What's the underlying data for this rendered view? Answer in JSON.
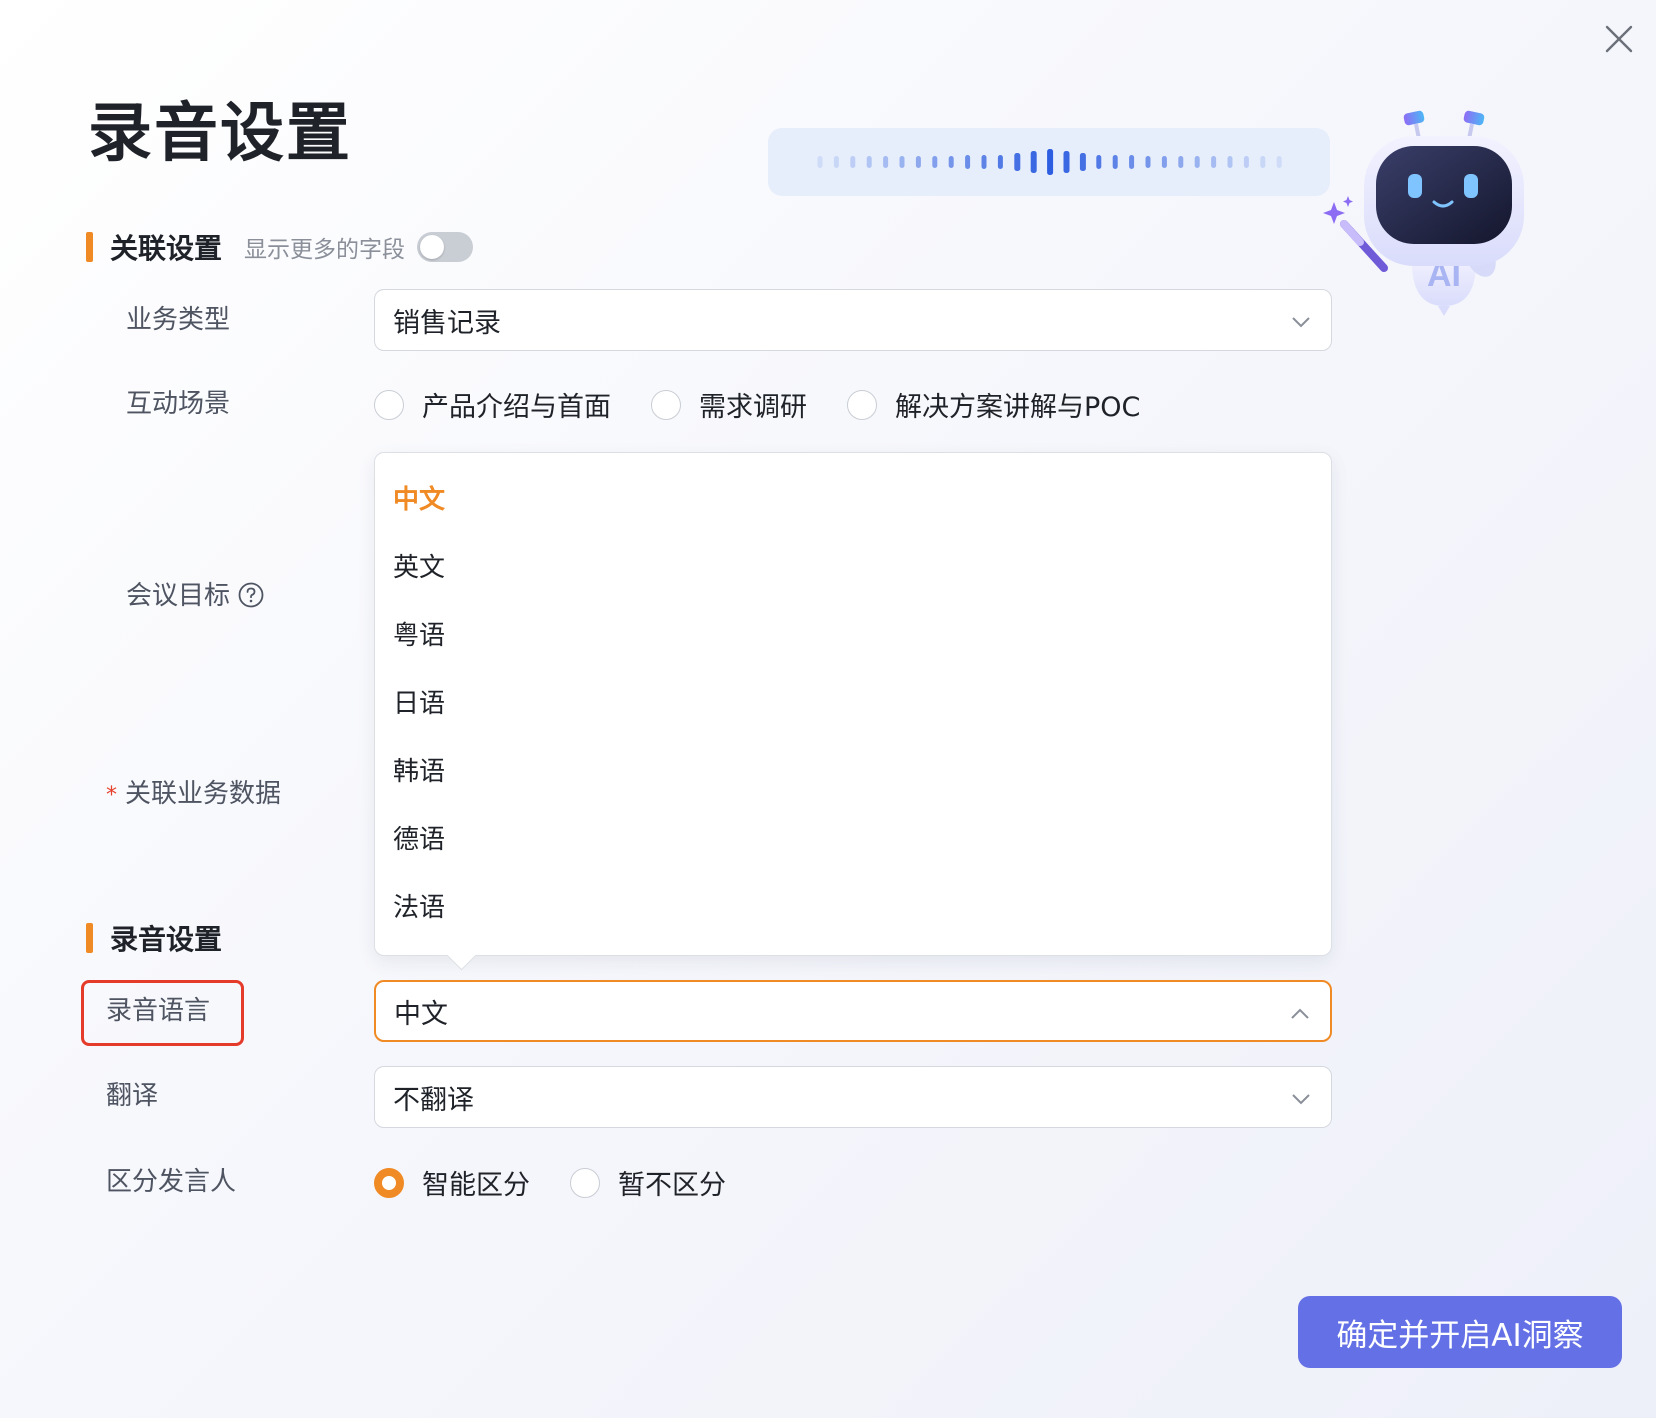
{
  "dialog": {
    "title": "录音设置",
    "close_icon": "close-icon"
  },
  "colors": {
    "accent": "#f08a24",
    "primary_button": "#6470e6",
    "highlight_box": "#e53b2a",
    "wave": "#2d5de0"
  },
  "association": {
    "section_title": "关联设置",
    "more_fields_hint": "显示更多的字段",
    "more_fields_toggle_on": false,
    "business_type": {
      "label": "业务类型",
      "value": "销售记录"
    },
    "scene": {
      "label": "互动场景",
      "options": [
        "产品介绍与首面",
        "需求调研",
        "解决方案讲解与POC"
      ]
    },
    "meeting_goal": {
      "label": "会议目标"
    },
    "business_data": {
      "label": "关联业务数据",
      "required_mark": "*"
    }
  },
  "language_dropdown": {
    "options": [
      "中文",
      "英文",
      "粤语",
      "日语",
      "韩语",
      "德语",
      "法语"
    ],
    "selected": "中文"
  },
  "recording": {
    "section_title": "录音设置",
    "language": {
      "label": "录音语言",
      "value": "中文"
    },
    "translate": {
      "label": "翻译",
      "value": "不翻译"
    },
    "speaker": {
      "label": "区分发言人",
      "options": [
        "智能区分",
        "暂不区分"
      ],
      "selected": "智能区分"
    }
  },
  "robot_badge": "AI",
  "confirm_button": "确定并开启AI洞察"
}
